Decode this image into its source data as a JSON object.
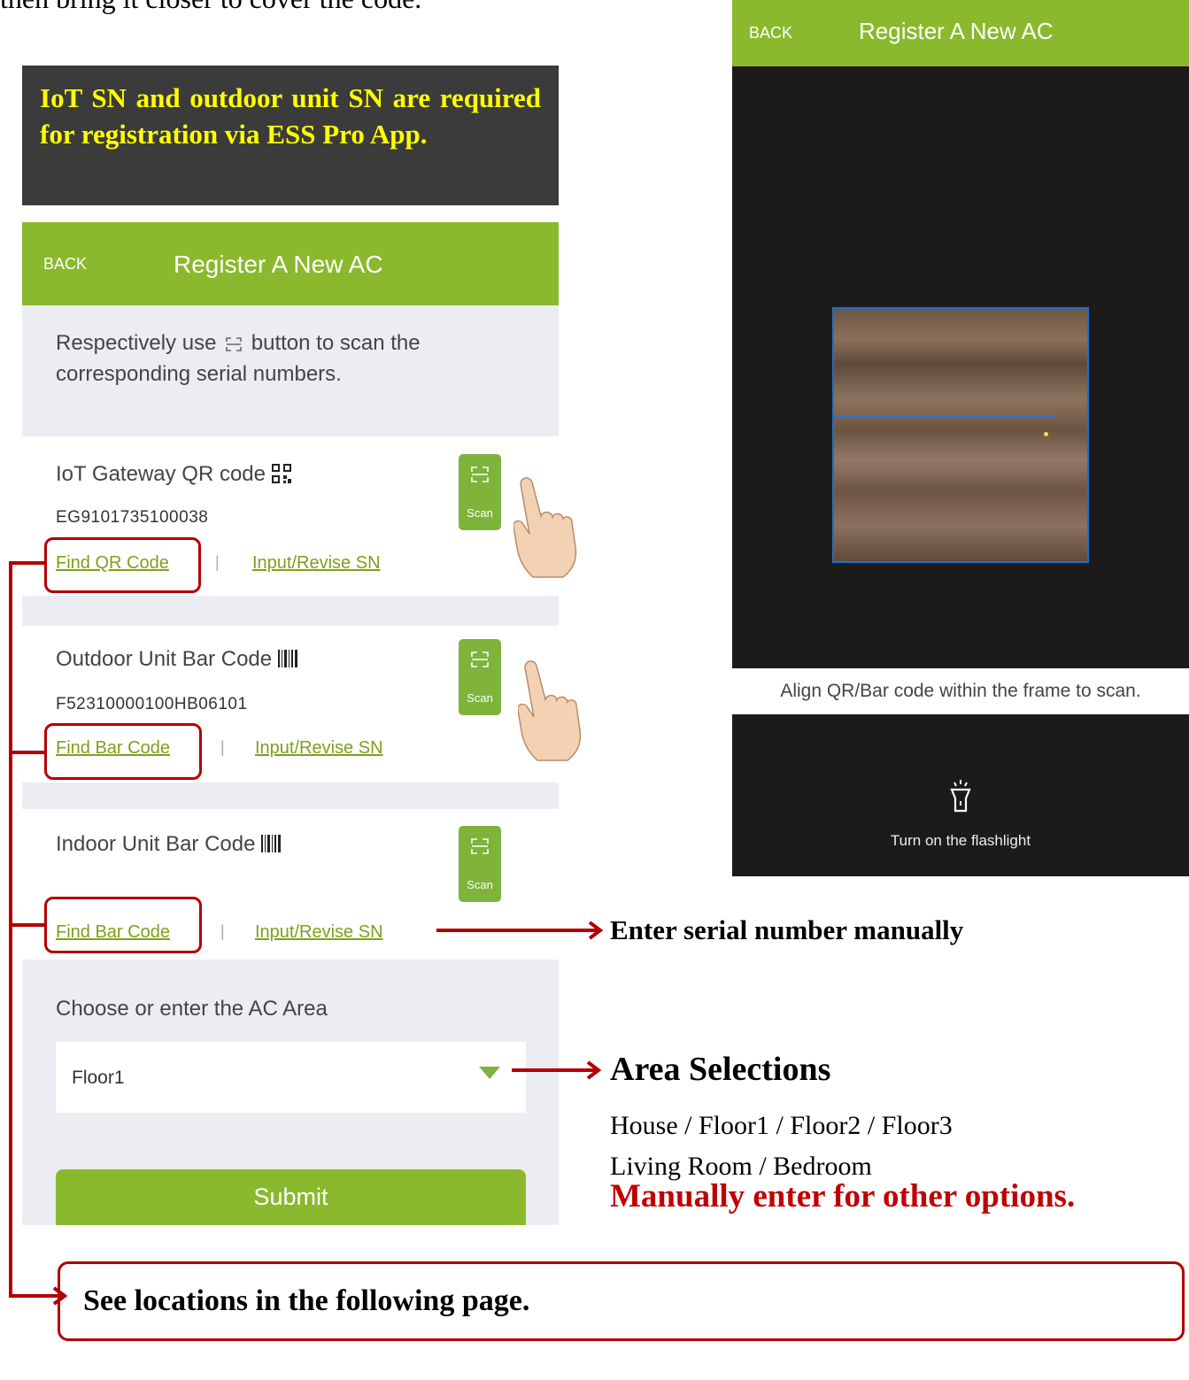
{
  "intro_text": "then bring it closer to cover the code.",
  "note": "IoT SN and outdoor unit SN are required for registration via ESS Pro App.",
  "app": {
    "back_label": "BACK",
    "title": "Register A New AC",
    "instruction_before": "Respectively use",
    "instruction_after": "button to scan the corresponding serial numbers.",
    "scan_label": "Scan",
    "iot": {
      "label": "IoT Gateway QR code",
      "sn": "EG9101735100038",
      "find_link": "Find QR Code",
      "input_link": "Input/Revise SN",
      "separator": "|"
    },
    "outdoor": {
      "label": "Outdoor Unit Bar Code",
      "sn": "F52310000100HB06101",
      "find_link": "Find Bar Code",
      "input_link": "Input/Revise SN",
      "separator": "|"
    },
    "indoor": {
      "label": "Indoor Unit Bar Code",
      "find_link": "Find Bar Code",
      "input_link": "Input/Revise SN",
      "separator": "|"
    },
    "area_label": "Choose or enter the AC Area",
    "area_value": "Floor1",
    "submit_label": "Submit"
  },
  "scanner": {
    "back_label": "BACK",
    "title": "Register A New AC",
    "align_text": "Align QR/Bar code within the frame to scan.",
    "flashlight_label": "Turn on the flashlight"
  },
  "annotations": {
    "manual_entry": "Enter serial number manually",
    "area_heading": "Area Selections",
    "area_options_line1": "House / Floor1 / Floor2 / Floor3",
    "area_options_line2": "Living Room / Bedroom",
    "manual_other": "Manually enter for other options.",
    "see_locations": "See locations in the following page."
  },
  "colors": {
    "green": "#8ab92d",
    "red": "#b30000",
    "note_bg": "#3b3b3b",
    "note_text": "#ffff00"
  }
}
